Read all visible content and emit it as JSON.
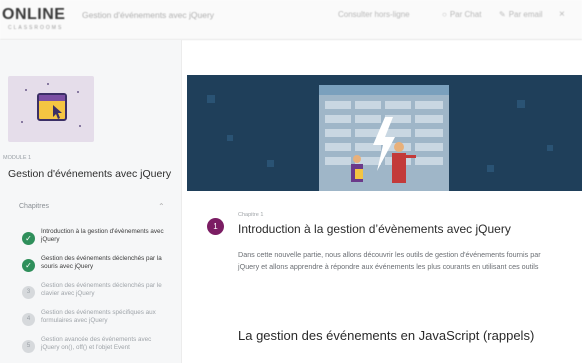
{
  "topbar": {
    "logo": "ONLINE",
    "logo_sub": "CLASSROOMS",
    "doc_title": "Gestion d'événements avec jQuery",
    "items": [
      {
        "label": "Consulter hors-ligne",
        "icon": "download-icon"
      },
      {
        "label": "Par Chat",
        "icon": "chat-icon"
      },
      {
        "label": "Par email",
        "icon": "pencil-icon"
      },
      {
        "label": "×",
        "icon": "close-icon"
      }
    ]
  },
  "sidebar": {
    "module_label": "MODULE 1",
    "module_title": "Gestion d'événements avec jQuery",
    "chapters_heading": "Chapitres",
    "chapters": [
      {
        "num": "✓",
        "label": "Introduction à la gestion d'évènements avec jQuery",
        "done": true
      },
      {
        "num": "✓",
        "label": "Gestion des événements déclenchés par la souris avec jQuery",
        "done": true
      },
      {
        "num": "3",
        "label": "Gestion des événements déclenchés par le clavier avec jQuery",
        "done": false
      },
      {
        "num": "4",
        "label": "Gestion des événements spécifiques aux formulaires avec jQuery",
        "done": false
      },
      {
        "num": "5",
        "label": "Gestion avancée des événements avec jQuery on(), off() et l'objet Event",
        "done": false
      }
    ]
  },
  "main": {
    "chapter_number": "1",
    "chapter_label": "Chapitre 1",
    "chapter_title": "Introduction à la gestion d’évènements avec jQuery",
    "paragraph": "Dans cette nouvelle partie, nous allons découvrir les outils de gestion d'événements fournis par jQuery et allons apprendre à répondre aux événements les plus courants en utilisant ces outils",
    "section_title": "La gestion des événements en JavaScript (rappels)"
  },
  "colors": {
    "accent": "#7b1d63",
    "done_green": "#2f8f5b",
    "hero_bg": "#1f3f5a"
  }
}
